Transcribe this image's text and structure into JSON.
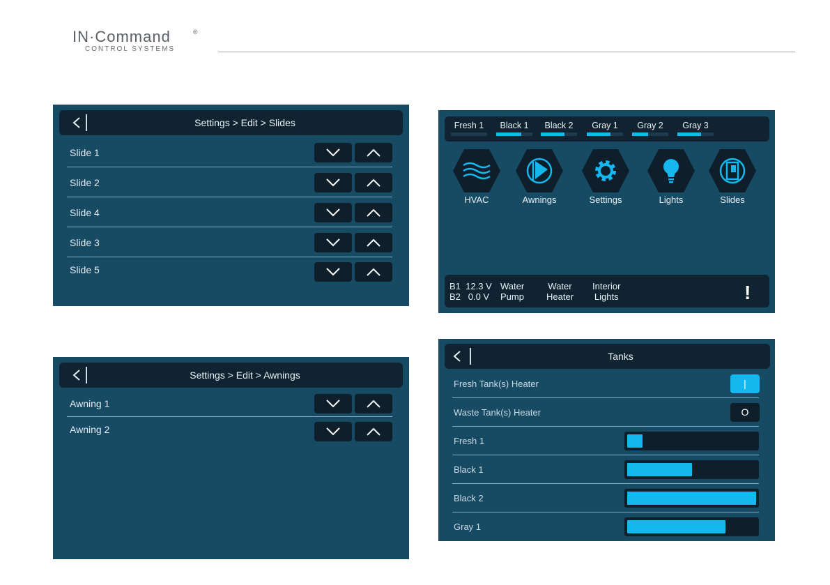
{
  "brand": {
    "name": "IN·Command",
    "reg": "®",
    "subtitle": "CONTROL SYSTEMS"
  },
  "colors": {
    "panel": "#174a63",
    "bar": "#0f2330",
    "button": "#0e1f2b",
    "accent": "#15b7ef",
    "text": "#e8f1f6"
  },
  "slides_screen": {
    "title": "Settings > Edit > Slides",
    "back_icon": "chevron-left-icon",
    "rows": [
      {
        "label": "Slide 1",
        "down_icon": "chevron-down-icon",
        "up_icon": "chevron-up-icon"
      },
      {
        "label": "Slide 2",
        "down_icon": "chevron-down-icon",
        "up_icon": "chevron-up-icon"
      },
      {
        "label": "Slide 4",
        "down_icon": "chevron-down-icon",
        "up_icon": "chevron-up-icon"
      },
      {
        "label": "Slide 3",
        "down_icon": "chevron-down-icon",
        "up_icon": "chevron-up-icon"
      },
      {
        "label": "Slide 5",
        "down_icon": "chevron-down-icon",
        "up_icon": "chevron-up-icon"
      }
    ]
  },
  "awnings_screen": {
    "title": "Settings > Edit > Awnings",
    "back_icon": "chevron-left-icon",
    "rows": [
      {
        "label": "Awning 1"
      },
      {
        "label": "Awning 2"
      }
    ]
  },
  "home_screen": {
    "tanks": [
      {
        "label": "Fresh 1",
        "level": 0.0
      },
      {
        "label": "Black 1",
        "level": 0.7
      },
      {
        "label": "Black 2",
        "level": 0.65
      },
      {
        "label": "Gray 1",
        "level": 0.65
      },
      {
        "label": "Gray 2",
        "level": 0.45
      },
      {
        "label": "Gray 3",
        "level": 0.65
      }
    ],
    "tiles": [
      {
        "label": "HVAC",
        "icon": "waves-icon"
      },
      {
        "label": "Awnings",
        "icon": "awning-icon"
      },
      {
        "label": "Settings",
        "icon": "gear-icon"
      },
      {
        "label": "Lights",
        "icon": "lightbulb-icon"
      },
      {
        "label": "Slides",
        "icon": "slide-out-icon"
      }
    ],
    "status": {
      "b1_label": "B1",
      "b1_value": "12.3 V",
      "b2_label": "B2",
      "b2_value": "0.0 V",
      "water_pump": [
        "Water",
        "Pump"
      ],
      "water_heater": [
        "Water",
        "Heater"
      ],
      "interior_lights": [
        "Interior",
        "Lights"
      ],
      "alert": "!"
    }
  },
  "tanks_screen": {
    "title": "Tanks",
    "back_icon": "chevron-left-icon",
    "heaters": [
      {
        "label": "Fresh Tank(s) Heater",
        "state": "on",
        "glyph": "|"
      },
      {
        "label": "Waste Tank(s) Heater",
        "state": "off",
        "glyph": "O"
      }
    ],
    "levels": [
      {
        "label": "Fresh 1",
        "level": 0.12
      },
      {
        "label": "Black 1",
        "level": 0.5
      },
      {
        "label": "Black 2",
        "level": 1.0
      },
      {
        "label": "Gray 1",
        "level": 0.76
      }
    ]
  }
}
